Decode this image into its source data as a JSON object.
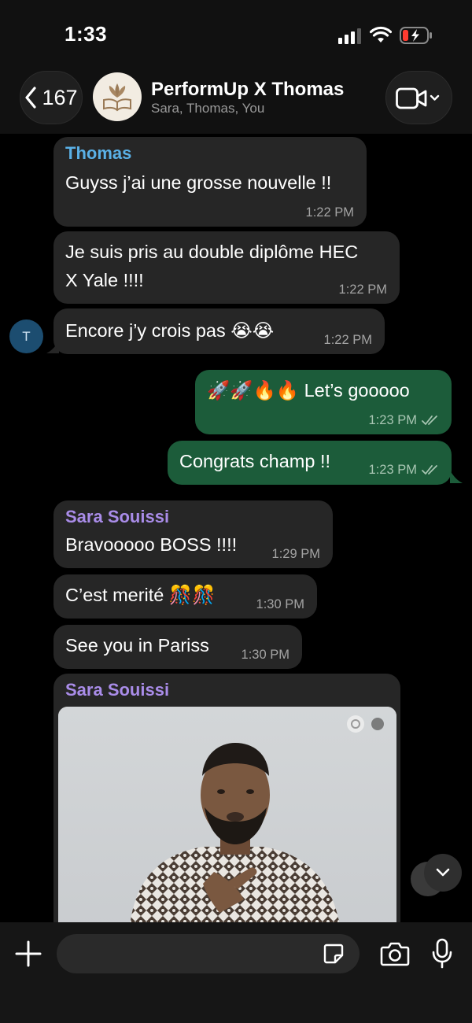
{
  "status_bar": {
    "time": "1:33"
  },
  "header": {
    "back_count": "167",
    "group_name": "PerformUp X Thomas",
    "members": "Sara, Thomas, You"
  },
  "messages": [
    {
      "sender": "Thomas",
      "lines": [
        "Guyss j’ai une grosse nouvelle !!"
      ],
      "time": "1:22 PM"
    },
    {
      "lines": [
        "Je suis pris au double diplôme HEC",
        "X Yale !!!!"
      ],
      "time": "1:22 PM"
    },
    {
      "lines": [
        "Encore j’y crois pas 😭😭"
      ],
      "time": "1:22 PM"
    },
    {
      "lines": [
        "🚀🚀🔥🔥 Let’s gooooo"
      ],
      "time": "1:23 PM"
    },
    {
      "lines": [
        "Congrats champ !!"
      ],
      "time": "1:23 PM"
    },
    {
      "sender": "Sara Souissi",
      "lines": [
        "Bravooooo BOSS !!!!"
      ],
      "time": "1:29 PM"
    },
    {
      "lines": [
        "C’est merité 🎊🎊"
      ],
      "time": "1:30 PM"
    },
    {
      "lines": [
        "See you in Pariss"
      ],
      "time": "1:30 PM"
    },
    {
      "sender": "Sara Souissi"
    }
  ],
  "avatar_initial": "T",
  "colors": {
    "thomas_name": "#5ab0e6",
    "sara_name": "#a98ce8",
    "outgoing_bubble": "#1c5c3a",
    "incoming_bubble": "#262626"
  },
  "icons": [
    "chevron-left-icon",
    "video-camera-icon",
    "plus-icon",
    "sticker-icon",
    "camera-icon",
    "microphone-icon",
    "chevron-down-icon",
    "double-check-icon"
  ]
}
